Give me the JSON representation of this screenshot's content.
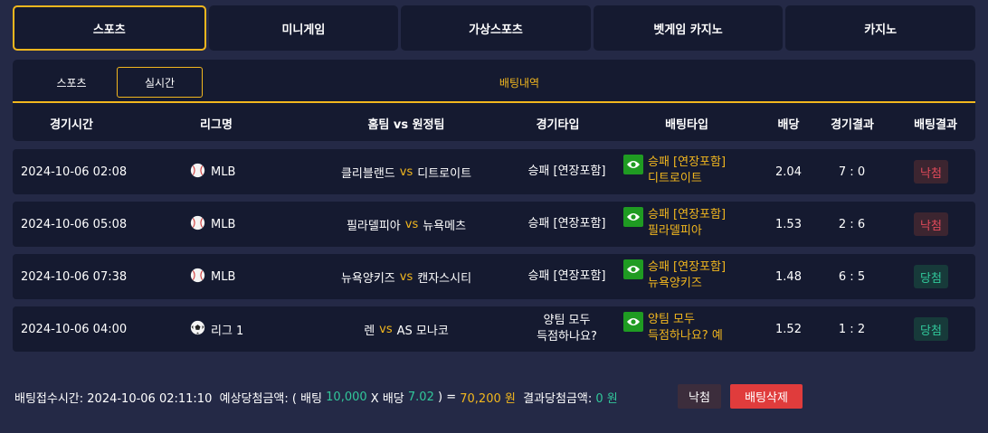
{
  "topnav": [
    "스포츠",
    "미니게임",
    "가상스포츠",
    "벳게임 카지노",
    "카지노"
  ],
  "subnav": {
    "sports": "스포츠",
    "live": "실시간",
    "history": "배팅내역"
  },
  "headers": {
    "time": "경기시간",
    "league": "리그명",
    "teams": "홈팀 vs 원정팀",
    "game_type": "경기타입",
    "bet_type": "배팅타입",
    "odds": "배당",
    "score": "경기결과",
    "result": "배팅결과"
  },
  "vs": "vs",
  "rows": [
    {
      "time": "2024-10-06 02:08",
      "league_icon": "baseball-icon",
      "league": "MLB",
      "home": "클리블랜드",
      "away": "디트로이트",
      "game_type": "승패 [연장포함]",
      "pick_line1": "승패 [연장포함]",
      "pick_line2": "디트로이트",
      "odds": "2.04",
      "score": "7 : 0",
      "result": "낙첨"
    },
    {
      "time": "2024-10-06 05:08",
      "league_icon": "baseball-icon",
      "league": "MLB",
      "home": "필라델피아",
      "away": "뉴욕메츠",
      "game_type": "승패 [연장포함]",
      "pick_line1": "승패 [연장포함]",
      "pick_line2": "필라델피아",
      "odds": "1.53",
      "score": "2 : 6",
      "result": "낙첨"
    },
    {
      "time": "2024-10-06 07:38",
      "league_icon": "baseball-icon",
      "league": "MLB",
      "home": "뉴욕양키즈",
      "away": "캔자스시티",
      "game_type": "승패 [연장포함]",
      "pick_line1": "승패 [연장포함]",
      "pick_line2": "뉴욕양키즈",
      "odds": "1.48",
      "score": "6 : 5",
      "result": "당첨"
    },
    {
      "time": "2024-10-06 04:00",
      "league_icon": "soccer-ball-icon",
      "league": "리그 1",
      "home": "렌",
      "away": "AS 모나코",
      "game_type_line1": "양팀 모두",
      "game_type_line2": "득점하나요?",
      "pick_line1": "양팀 모두",
      "pick_line2": "득점하나요? 예",
      "odds": "1.52",
      "score": "1 : 2",
      "result": "당첨"
    }
  ],
  "footer": {
    "received_label": "배팅접수시간: 2024-10-06 02:11:10",
    "expected_label": "예상당첨금액: ( 배팅",
    "bet_amount": "10,000",
    "x": "X 배당",
    "total_odds": "7.02",
    "eq": ") =",
    "expected_win": "70,200 원",
    "actual_label": "결과당첨금액:",
    "actual_amount": "0 원",
    "status_button": "낙첨",
    "delete_button": "배팅삭제"
  },
  "colors": {
    "accent": "#f2b71e",
    "win": "#31c79a",
    "lose": "#e04a5a",
    "pick_icon": "#1f9b22"
  }
}
